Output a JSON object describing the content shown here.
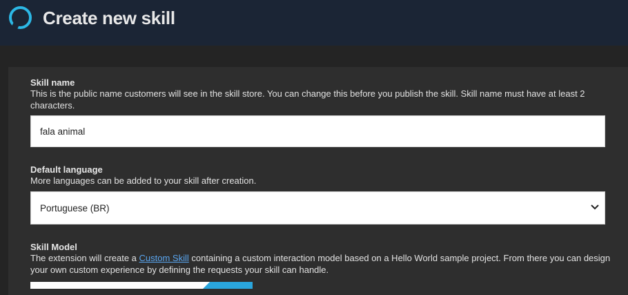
{
  "header": {
    "title": "Create new skill",
    "logo_icon": "alexa-ring-icon",
    "background": "#1b2535",
    "accent": "#2cb8e6"
  },
  "form": {
    "skill_name": {
      "label": "Skill name",
      "description": "This is the public name customers will see in the skill store. You can change this before you publish the skill. Skill name must have at least 2 characters.",
      "value": "fala animal"
    },
    "default_language": {
      "label": "Default language",
      "description": "More languages can be added to your skill after creation.",
      "selected": "Portuguese (BR)",
      "dropdown_icon": "chevron-down-icon"
    },
    "skill_model": {
      "label": "Skill Model",
      "description_before": "The extension will create a ",
      "link_text": "Custom Skill",
      "description_after": " containing a custom interaction model based on a Hello World sample project. From there you can design your own custom experience by defining the requests your skill can handle."
    }
  }
}
